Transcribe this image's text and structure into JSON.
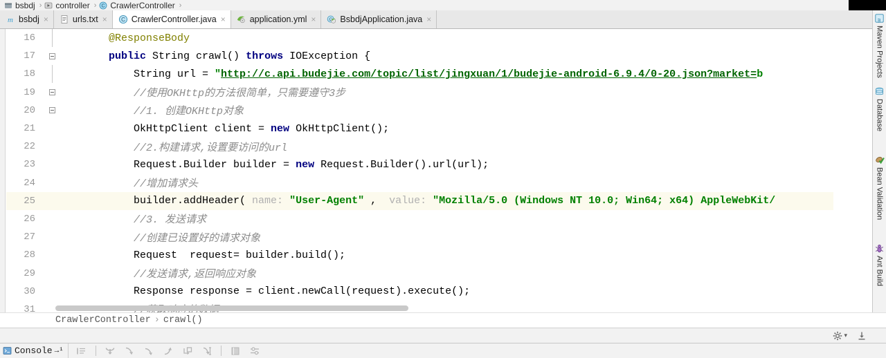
{
  "breadcrumb_top": {
    "items": [
      {
        "label": "bsbdj",
        "icon": "module-icon"
      },
      {
        "label": "controller",
        "icon": "package-icon"
      },
      {
        "label": "CrawlerController",
        "icon": "class-icon"
      }
    ],
    "separator": "›"
  },
  "tabs": [
    {
      "label": "bsbdj",
      "icon": "maven-module-icon",
      "active": false,
      "close": "×"
    },
    {
      "label": "urls.txt",
      "icon": "text-file-icon",
      "active": false,
      "close": "×"
    },
    {
      "label": "CrawlerController.java",
      "icon": "java-class-icon",
      "active": true,
      "close": "×"
    },
    {
      "label": "application.yml",
      "icon": "yml-file-icon",
      "active": false,
      "close": "×"
    },
    {
      "label": "BsbdjApplication.java",
      "icon": "spring-class-icon",
      "active": false,
      "close": "×"
    }
  ],
  "editor": {
    "lines": [
      {
        "num": "16",
        "fold": "bar",
        "highlight": false,
        "spans": [
          {
            "t": "    ",
            "c": "plain"
          },
          {
            "t": "@ResponseBody",
            "c": "ann"
          }
        ]
      },
      {
        "num": "17",
        "fold": "box",
        "highlight": false,
        "spans": [
          {
            "t": "    ",
            "c": "plain"
          },
          {
            "t": "public",
            "c": "kw"
          },
          {
            "t": " String crawl() ",
            "c": "plain"
          },
          {
            "t": "throws",
            "c": "kw"
          },
          {
            "t": " IOException {",
            "c": "plain"
          }
        ]
      },
      {
        "num": "18",
        "fold": "bar",
        "highlight": false,
        "spans": [
          {
            "t": "        String url = ",
            "c": "plain"
          },
          {
            "t": "\"",
            "c": "str"
          },
          {
            "t": "http://c.api.budejie.com/topic/list/jingxuan/1/budejie-android-6.9.4/0-20.json?market=",
            "c": "link"
          },
          {
            "t": "b",
            "c": "str"
          }
        ]
      },
      {
        "num": "19",
        "fold": "box",
        "highlight": false,
        "spans": [
          {
            "t": "        //使用OKHttp的方法很简单，只需要遵守3步",
            "c": "cmt"
          }
        ]
      },
      {
        "num": "20",
        "fold": "box",
        "highlight": false,
        "spans": [
          {
            "t": "        //1. 创建OKHttp对象",
            "c": "cmt"
          }
        ]
      },
      {
        "num": "21",
        "fold": "none",
        "highlight": false,
        "spans": [
          {
            "t": "        OkHttpClient client = ",
            "c": "plain"
          },
          {
            "t": "new",
            "c": "kw"
          },
          {
            "t": " OkHttpClient();",
            "c": "plain"
          }
        ]
      },
      {
        "num": "22",
        "fold": "none",
        "highlight": false,
        "spans": [
          {
            "t": "        //2.构建请求,设置要访问的url",
            "c": "cmt"
          }
        ]
      },
      {
        "num": "23",
        "fold": "none",
        "highlight": false,
        "spans": [
          {
            "t": "        Request.Builder builder = ",
            "c": "plain"
          },
          {
            "t": "new",
            "c": "kw"
          },
          {
            "t": " Request.Builder().url(url);",
            "c": "plain"
          }
        ]
      },
      {
        "num": "24",
        "fold": "none",
        "highlight": false,
        "spans": [
          {
            "t": "        //增加请求头",
            "c": "cmt"
          }
        ]
      },
      {
        "num": "25",
        "fold": "none",
        "highlight": true,
        "spans": [
          {
            "t": "        builder.addHeader(",
            "c": "plain"
          },
          {
            "t": " name: ",
            "c": "hint"
          },
          {
            "t": "\"User-Agent\"",
            "c": "str"
          },
          {
            "t": " , ",
            "c": "plain"
          },
          {
            "t": " value: ",
            "c": "hint"
          },
          {
            "t": "\"Mozilla/5.0 (Windows NT 10.0; Win64; x64) AppleWebKit/",
            "c": "str"
          }
        ]
      },
      {
        "num": "26",
        "fold": "none",
        "highlight": false,
        "spans": [
          {
            "t": "        //3. 发送请求",
            "c": "cmt"
          }
        ]
      },
      {
        "num": "27",
        "fold": "none",
        "highlight": false,
        "spans": [
          {
            "t": "        //创建已设置好的请求对象",
            "c": "cmt"
          }
        ]
      },
      {
        "num": "28",
        "fold": "none",
        "highlight": false,
        "spans": [
          {
            "t": "        Request  request= builder.build();",
            "c": "plain"
          }
        ]
      },
      {
        "num": "29",
        "fold": "none",
        "highlight": false,
        "spans": [
          {
            "t": "        //发送请求,返回响应对象",
            "c": "cmt"
          }
        ]
      },
      {
        "num": "30",
        "fold": "none",
        "highlight": false,
        "spans": [
          {
            "t": "        Response response = client.newCall(request).execute();",
            "c": "plain"
          }
        ]
      },
      {
        "num": "31",
        "fold": "none",
        "highlight": false,
        "spans": [
          {
            "t": "        //获取响应的数据",
            "c": "cmt"
          }
        ]
      }
    ]
  },
  "bottom_breadcrumb": {
    "class": "CrawlerController",
    "separator": "›",
    "method": "crawl()"
  },
  "settings_row": {
    "gear_icon": "gear-icon",
    "gear_chevron": "▾",
    "download_icon": "download-icon"
  },
  "console": {
    "tab_label": "Console",
    "tab_suffix": "→¹",
    "tab_icon": "console-icon",
    "tools": [
      {
        "icon": "soft-wrap-icon"
      },
      {
        "icon": "step-over-icon"
      },
      {
        "icon": "step-into-icon"
      },
      {
        "icon": "force-step-into-icon"
      },
      {
        "icon": "step-out-icon"
      },
      {
        "icon": "drop-frame-icon"
      },
      {
        "icon": "run-to-cursor-icon"
      },
      {
        "icon": "evaluate-expression-icon"
      },
      {
        "icon": "settings-filter-icon"
      }
    ]
  },
  "right_toolbar": {
    "items": [
      {
        "label": "Maven Projects",
        "icon": "maven-icon"
      },
      {
        "label": "Database",
        "icon": "database-icon"
      },
      {
        "label": "Bean Validation",
        "icon": "bean-validation-icon"
      },
      {
        "label": "Ant Build",
        "icon": "ant-icon"
      }
    ]
  },
  "colors": {
    "editor_bg": "#ffffff",
    "chrome_bg": "#f2f2f2",
    "tab_active_bg": "#ffffff",
    "keyword": "#000080",
    "string": "#008000",
    "comment": "#8c8c8c",
    "annotation": "#808000",
    "highlight_line": "#fcfaed",
    "error_stripe_warn": "#e8c547"
  }
}
